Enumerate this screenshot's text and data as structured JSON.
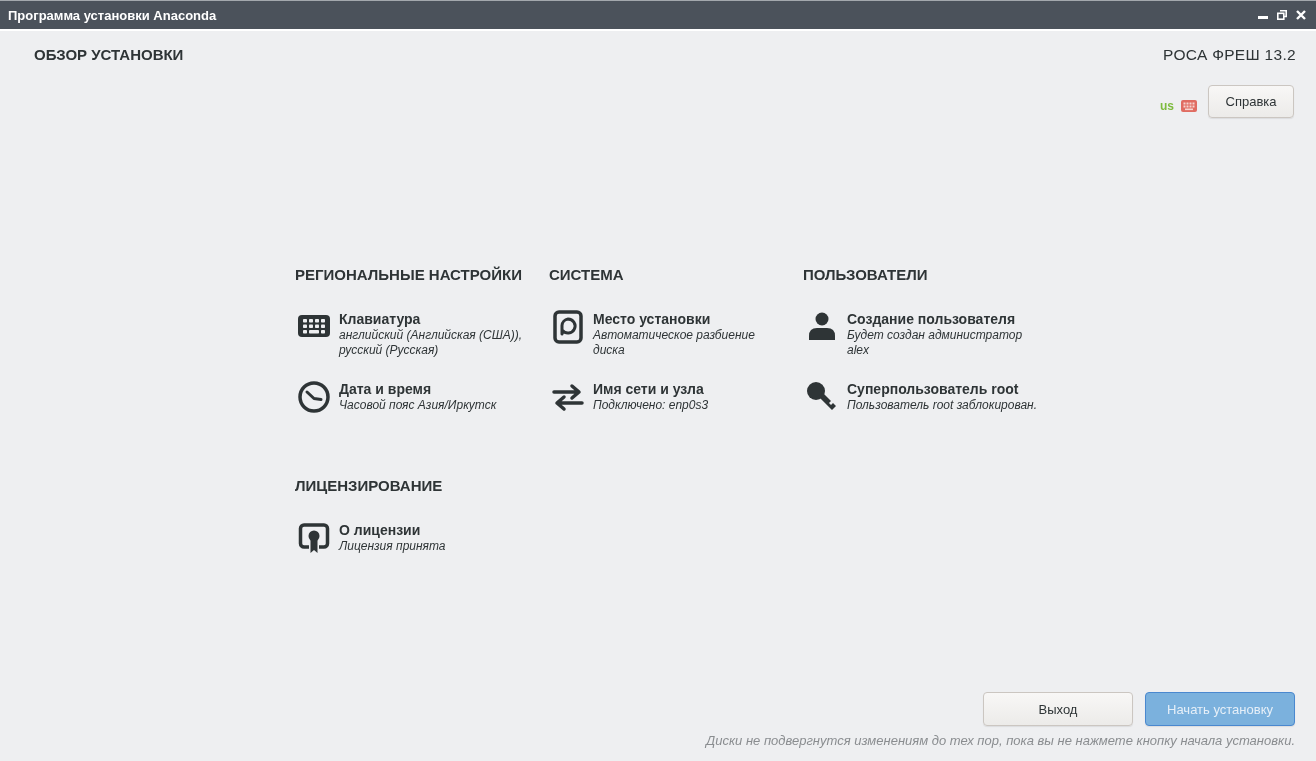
{
  "window": {
    "title": "Программа установки Anaconda"
  },
  "header": {
    "title": "ОБЗОР УСТАНОВКИ",
    "product": "РОСА ФРЕШ 13.2",
    "keyboard_layout": "us",
    "help_button": "Справка"
  },
  "categories": [
    {
      "title": "РЕГИОНАЛЬНЫЕ НАСТРОЙКИ",
      "spokes": [
        {
          "kind": "keyboard",
          "title": "Клавиатура",
          "status": "английский (Английская (США)), русский (Русская)"
        },
        {
          "kind": "datetime",
          "title": "Дата и время",
          "status": "Часовой пояс Азия/Иркутск"
        }
      ]
    },
    {
      "title": "СИСТЕМА",
      "spokes": [
        {
          "kind": "storage",
          "title": "Место установки",
          "status": "Автоматическое разбиение диска"
        },
        {
          "kind": "network",
          "title": "Имя сети и узла",
          "status": "Подключено: enp0s3"
        }
      ]
    },
    {
      "title": "ПОЛЬЗОВАТЕЛИ",
      "spokes": [
        {
          "kind": "user",
          "title": "Создание пользователя",
          "status": "Будет создан администратор alex"
        },
        {
          "kind": "root",
          "title": "Суперпользователь root",
          "status": "Пользователь root заблокирован."
        }
      ]
    },
    {
      "title": "ЛИЦЕНЗИРОВАНИЕ",
      "spokes": [
        {
          "kind": "license",
          "title": "О лицензии",
          "status": "Лицензия принята"
        }
      ]
    }
  ],
  "footer": {
    "buttons": [
      {
        "kind": "secondary",
        "label": "Выход",
        "disabled": false
      },
      {
        "kind": "primary",
        "label": "Начать установку",
        "disabled": true
      }
    ],
    "note": "Диски не подвергнутся изменениям до тех пор, пока вы не нажмете кнопку начала установки."
  }
}
